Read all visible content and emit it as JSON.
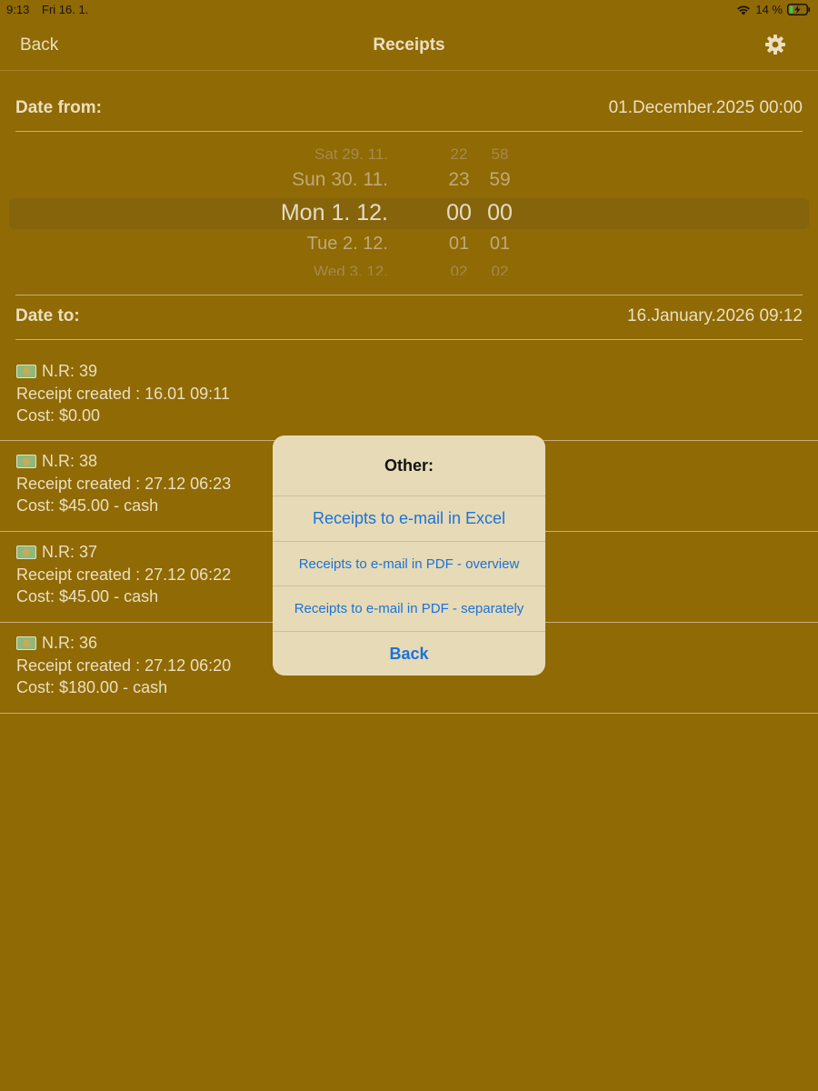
{
  "status_bar": {
    "time": "9:13",
    "date": "Fri 16. 1.",
    "battery": "14 %",
    "wifi_icon": "wifi-icon",
    "battery_icon": "battery-charging-icon"
  },
  "nav": {
    "back_label": "Back",
    "title": "Receipts",
    "settings_icon": "gear-icon"
  },
  "date_from": {
    "label": "Date from:",
    "value": "01.December.2025 00:00"
  },
  "picker": {
    "rows": [
      {
        "day": "Sat 29. 11.",
        "hour": "22",
        "minute": "58"
      },
      {
        "day": "Sun 30. 11.",
        "hour": "23",
        "minute": "59"
      },
      {
        "day": "Mon 1. 12.",
        "hour": "00",
        "minute": "00"
      },
      {
        "day": "Tue 2. 12.",
        "hour": "01",
        "minute": "01"
      },
      {
        "day": "Wed 3. 12.",
        "hour": "02",
        "minute": "02"
      }
    ]
  },
  "date_to": {
    "label": "Date to:",
    "value": "16.January.2026 09:12"
  },
  "receipts": [
    {
      "number": "N.R: 39",
      "created": "Receipt created : 16.01 09:11",
      "cost": "Cost: $0.00"
    },
    {
      "number": "N.R: 38",
      "created": "Receipt created : 27.12 06:23",
      "cost": "Cost: $45.00 - cash"
    },
    {
      "number": "N.R: 37",
      "created": "Receipt created : 27.12 06:22",
      "cost": "Cost: $45.00 - cash"
    },
    {
      "number": "N.R: 36",
      "created": "Receipt created : 27.12 06:20",
      "cost": "Cost: $180.00 - cash"
    }
  ],
  "action_sheet": {
    "title": "Other:",
    "excel": "Receipts to e-mail in Excel",
    "pdf_overview": "Receipts to e-mail in PDF - overview",
    "pdf_separately": "Receipts to e-mail in PDF - separately",
    "back": "Back"
  },
  "colors": {
    "background": "#8f6a05",
    "sheet_background": "#e7dab6",
    "action_blue": "#1a73d9",
    "text_light": "#ecdfc0"
  }
}
